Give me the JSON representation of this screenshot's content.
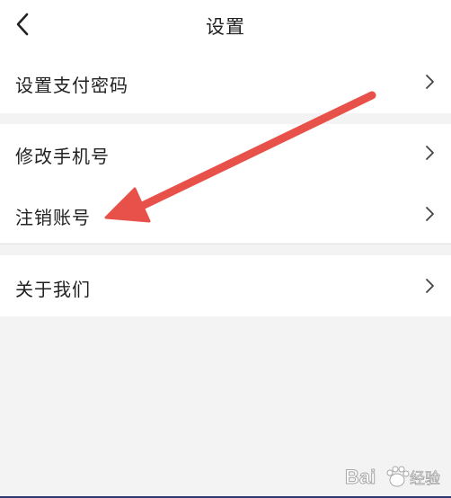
{
  "header": {
    "title": "设置",
    "back_icon": "chevron-left-icon"
  },
  "settings": {
    "items": [
      {
        "label": "设置支付密码",
        "icon": "chevron-right-icon"
      },
      {
        "label": "修改手机号",
        "icon": "chevron-right-icon"
      },
      {
        "label": "注销账号",
        "icon": "chevron-right-icon"
      },
      {
        "label": "关于我们",
        "icon": "chevron-right-icon"
      }
    ]
  },
  "annotation": {
    "arrow_color": "#e8514a",
    "points_to": "注销账号"
  },
  "watermark": {
    "text": "Bai 经验",
    "icon": "baidu-paw-icon"
  },
  "colors": {
    "background": "#f3f3f3",
    "surface": "#ffffff",
    "text": "#222222",
    "chevron": "#444444"
  }
}
